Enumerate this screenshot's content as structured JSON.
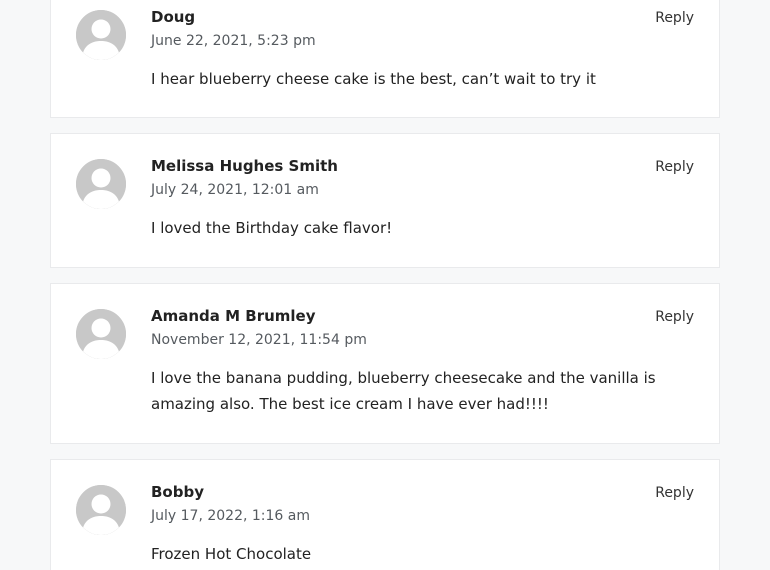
{
  "comments": [
    {
      "author": "Doug",
      "date": "June 22, 2021, 5:23 pm",
      "text": "I hear blueberry cheese cake is the best, can’t wait to try it",
      "reply_label": "Reply",
      "avatar_icon": "default-user-avatar-icon"
    },
    {
      "author": "Melissa Hughes Smith",
      "date": "July 24, 2021, 12:01 am",
      "text": "I loved the Birthday cake flavor!",
      "reply_label": "Reply",
      "avatar_icon": "default-user-avatar-icon"
    },
    {
      "author": "Amanda M Brumley",
      "date": "November 12, 2021, 11:54 pm",
      "text": "I love the banana pudding, blueberry cheesecake and the vanilla is amazing also. The best ice cream I have ever had!!!!",
      "reply_label": "Reply",
      "avatar_icon": "default-user-avatar-icon"
    },
    {
      "author": "Bobby",
      "date": "July 17, 2022, 1:16 am",
      "text": "Frozen Hot Chocolate",
      "reply_label": "Reply",
      "avatar_icon": "default-user-avatar-icon"
    }
  ],
  "colors": {
    "page_background": "#f7f8f9",
    "card_background": "#ffffff",
    "card_border": "#e9eaec",
    "avatar_background": "#c8c8c8",
    "text": "#222222",
    "meta_text": "#555a5f"
  }
}
